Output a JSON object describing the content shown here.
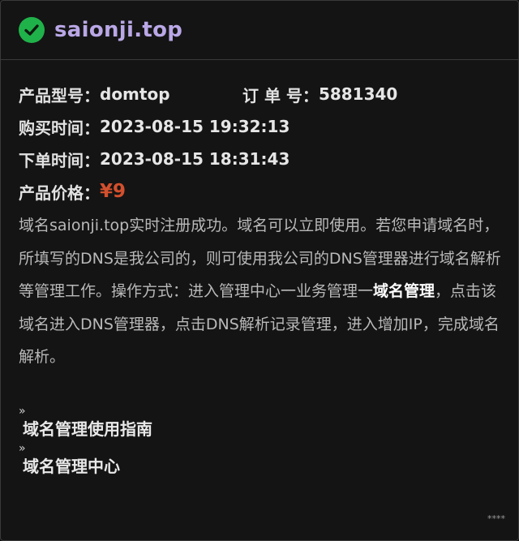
{
  "header": {
    "icon": "check-circle-icon",
    "icon_color": "#20b24a",
    "domain": "saionji.top"
  },
  "order": {
    "product_label": "产品型号：",
    "product_value": "domtop",
    "order_no_label": "订 单 号：",
    "order_no_value": "5881340",
    "purchase_time_label": "购买时间：",
    "purchase_time_value": "2023-08-15 19:32:13",
    "order_time_label": "下单时间：",
    "order_time_value": "2023-08-15 18:31:43",
    "price_label": "产品价格：",
    "price_value": "¥9"
  },
  "description": {
    "part1": "域名saionji.top实时注册成功。域名可以立即使用。若您申请域名时，所填写的DNS是我公司的，则可使用我公司的DNS管理器进行域名解析等管理工作。操作方式：进入管理中心一业务管理一",
    "highlight": "域名管理",
    "part2": "，点击该域名进入DNS管理器，点击DNS解析记录管理，进入增加IP，完成域名解析。"
  },
  "links": [
    {
      "arrow": "»",
      "label": "域名管理使用指南"
    },
    {
      "arrow": "»",
      "label": "域名管理中心"
    }
  ],
  "footer": {
    "mark": "****"
  },
  "colors": {
    "accent_title": "#b9a7e6",
    "price": "#d2502d",
    "success": "#20b24a"
  }
}
